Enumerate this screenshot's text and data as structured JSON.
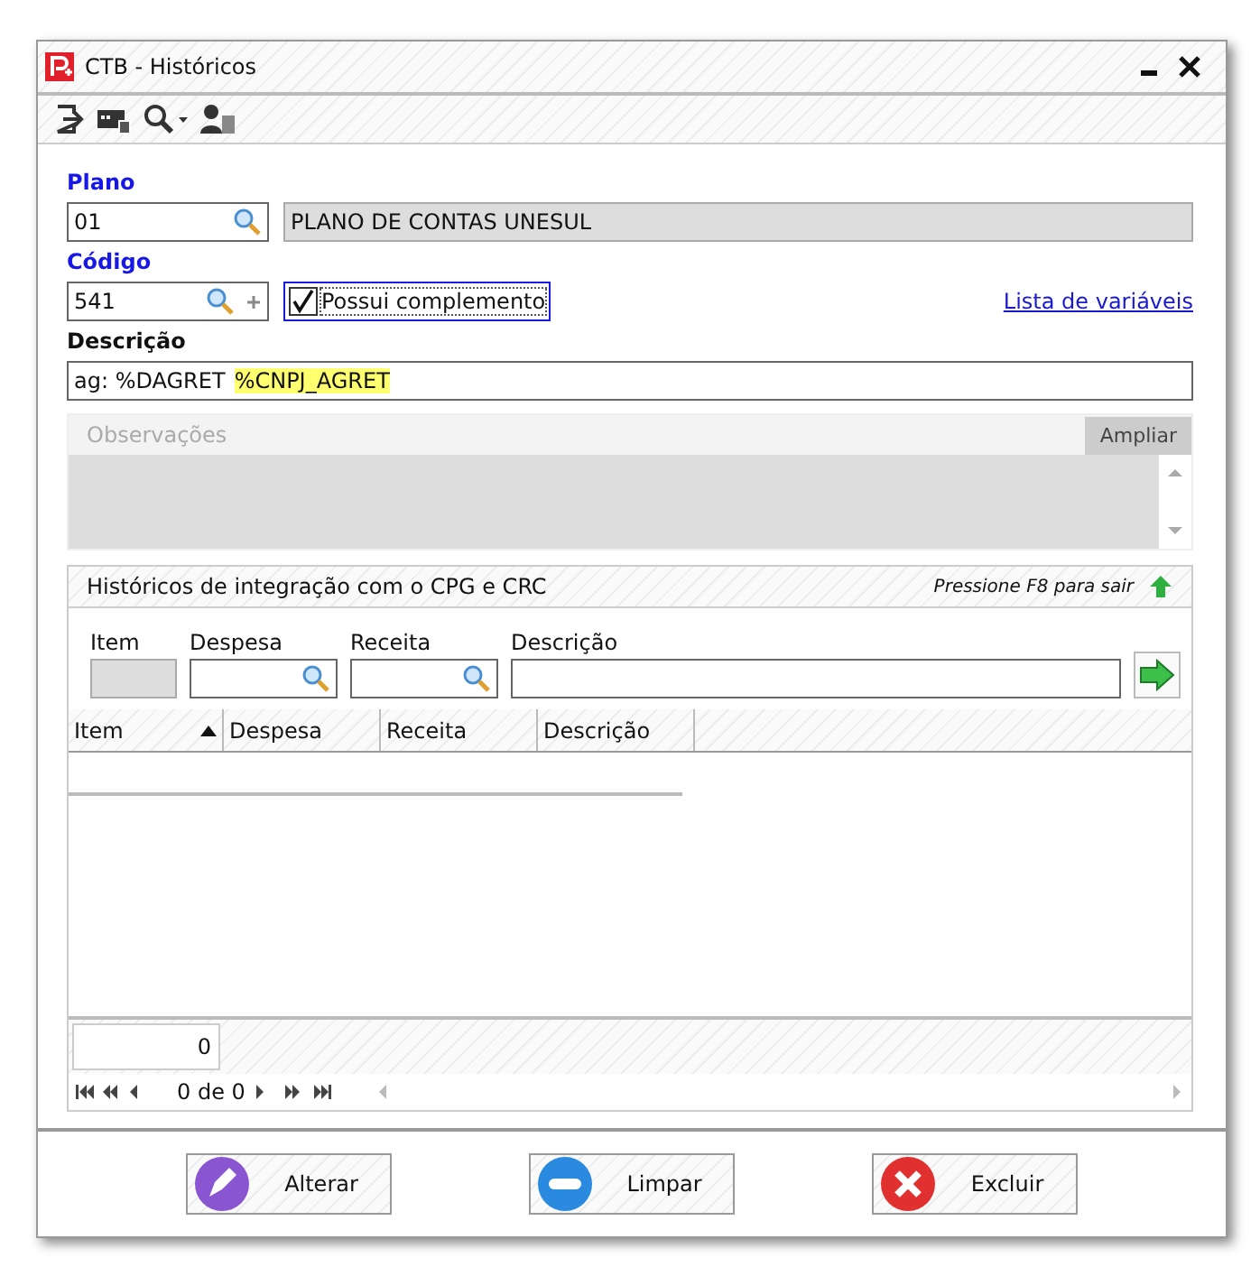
{
  "window": {
    "title": "CTB - Históricos"
  },
  "plano": {
    "label": "Plano",
    "value": "01",
    "lookup": "PLANO DE CONTAS UNESUL"
  },
  "codigo": {
    "label": "Código",
    "value": "541",
    "complement": {
      "label": "Possui complemento",
      "checked": true
    },
    "link": "Lista de variáveis"
  },
  "descricao": {
    "label": "Descrição",
    "parts": [
      {
        "text": "ag: %DAGRET",
        "highlighted": false
      },
      {
        "text": "%CNPJ_AGRET",
        "highlighted": true
      }
    ]
  },
  "observacoes": {
    "placeholder": "Observações",
    "button": "Ampliar"
  },
  "integration": {
    "title": "Históricos de integração com o CPG e CRC",
    "hint": "Pressione F8 para sair",
    "fields": [
      {
        "label": "Item",
        "kind": "disabled"
      },
      {
        "label": "Despesa",
        "kind": "lookup"
      },
      {
        "label": "Receita",
        "kind": "lookup"
      },
      {
        "label": "Descrição",
        "kind": "text"
      }
    ],
    "columns": [
      {
        "label": "Item",
        "sorted": true
      },
      {
        "label": "Despesa",
        "sorted": false
      },
      {
        "label": "Receita",
        "sorted": false
      },
      {
        "label": "Descrição",
        "sorted": false
      }
    ],
    "total": "0",
    "pager": "0 de 0"
  },
  "buttons": [
    {
      "label": "Alterar",
      "kind": "edit"
    },
    {
      "label": "Limpar",
      "kind": "clear"
    },
    {
      "label": "Excluir",
      "kind": "delete"
    }
  ]
}
